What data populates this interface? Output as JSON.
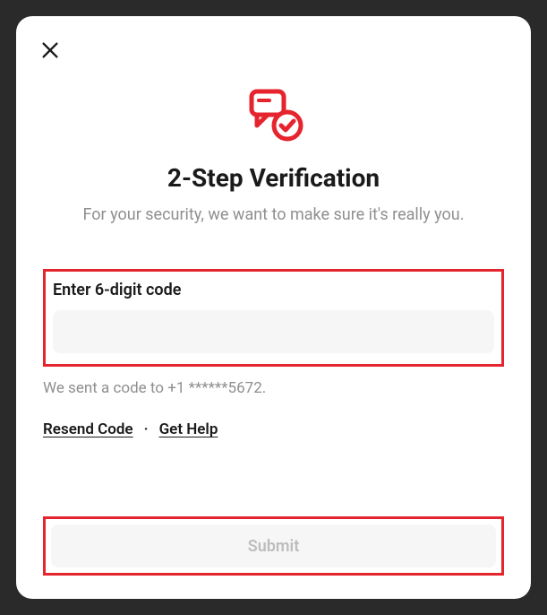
{
  "modal": {
    "title": "2-Step Verification",
    "subtitle": "For your security, we want to make sure it's really you.",
    "code_label": "Enter 6-digit code",
    "code_value": "",
    "code_placeholder": "",
    "sent_message": "We sent a code to +1 ******5672.",
    "resend_label": "Resend Code",
    "help_label": "Get Help",
    "separator": "·",
    "submit_label": "Submit"
  },
  "colors": {
    "accent": "#e6242e",
    "muted": "#8f8f8f",
    "input_bg": "#f6f6f6"
  }
}
